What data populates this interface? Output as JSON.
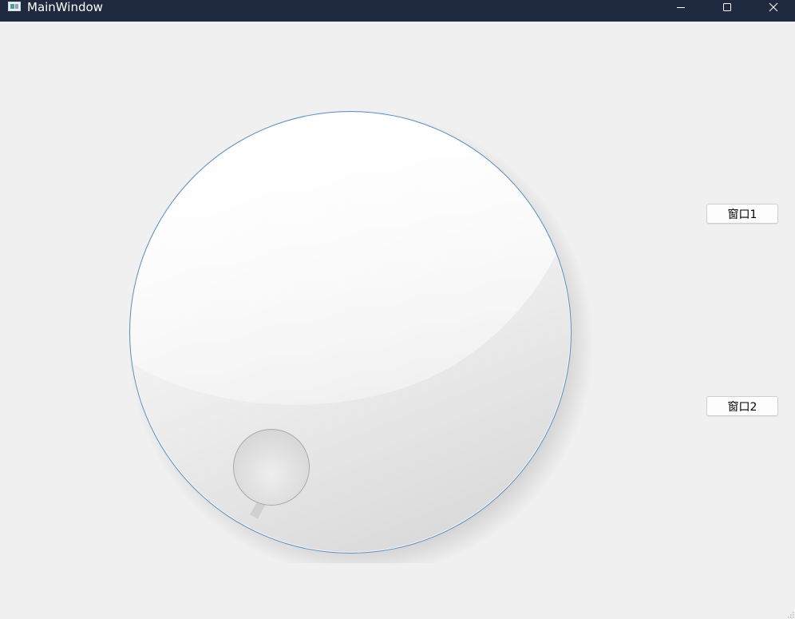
{
  "window": {
    "title": "MainWindow",
    "titlebar_color": "#1f2a40",
    "background": "#f0f0f0"
  },
  "controls": {
    "minimize_icon": "minimize-icon",
    "maximize_icon": "maximize-icon",
    "close_icon": "close-icon"
  },
  "buttons": {
    "window1_label": "窗口1",
    "window2_label": "窗口2"
  },
  "dial": {
    "accent_ring": "#5a8fc0",
    "face_light": "#ffffff",
    "face_dark": "#dcdcdc"
  }
}
